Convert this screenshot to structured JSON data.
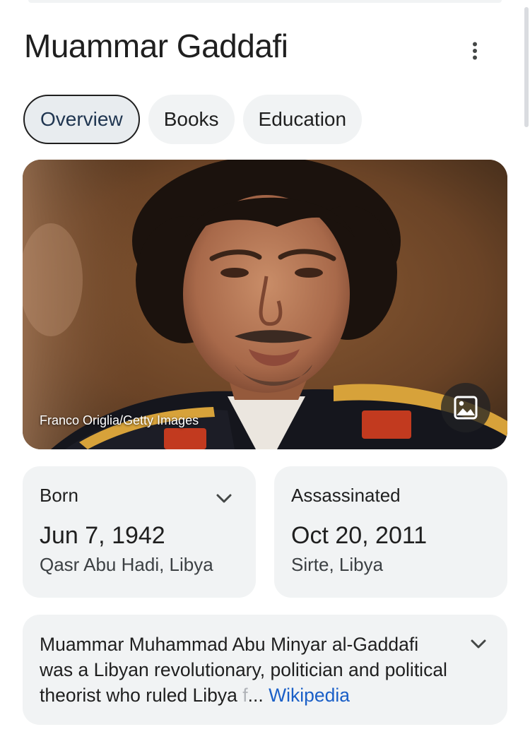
{
  "header": {
    "title": "Muammar Gaddafi",
    "more_icon": "more-vert-icon"
  },
  "tabs": [
    {
      "label": "Overview",
      "active": true
    },
    {
      "label": "Books",
      "active": false
    },
    {
      "label": "Education",
      "active": false
    }
  ],
  "photo": {
    "credit": "Franco Origlia/Getty Images",
    "gallery_icon": "image-icon"
  },
  "facts": {
    "born": {
      "label": "Born",
      "date": "Jun 7, 1942",
      "place": "Qasr Abu Hadi, Libya"
    },
    "died": {
      "label": "Assassinated",
      "date": "Oct 20, 2011",
      "place": "Sirte, Libya"
    }
  },
  "description": {
    "text": "Muammar Muhammad Abu Minyar al-Gaddafi was a Libyan revolutionary, politician and political theorist who ruled Libya ",
    "fade": "f",
    "ellipsis": "... ",
    "source": "Wikipedia"
  },
  "colors": {
    "accent_link": "#1a5fc7",
    "card_bg": "#f1f3f4",
    "active_tab_text": "#1f3550"
  }
}
